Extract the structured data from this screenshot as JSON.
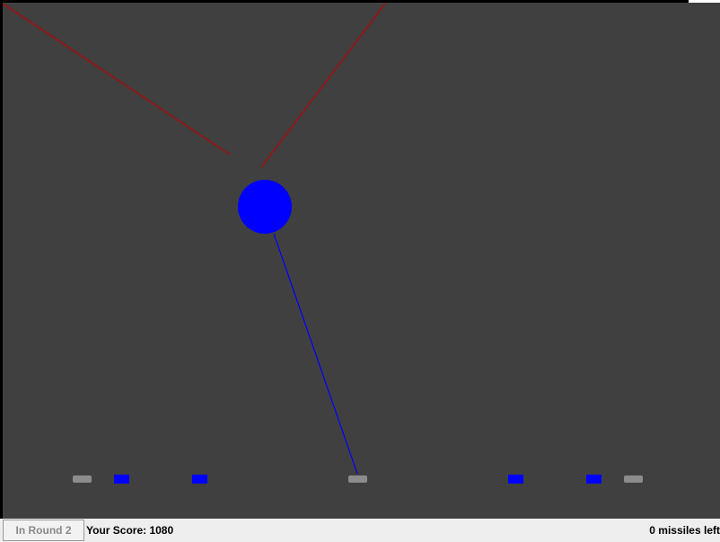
{
  "game": {
    "colors": {
      "background": "#404040",
      "enemy_missile_trail": "#8b1a1a",
      "player_missile": "#0000ff",
      "explosion": "#0000ff",
      "active_target": "#0000ff",
      "destroyed_target": "#8c8c8c"
    },
    "enemy_missile_count": 2,
    "player_missile_count": 1,
    "explosion_count": 1,
    "ground_targets": [
      {
        "state": "destroyed"
      },
      {
        "state": "active"
      },
      {
        "state": "active"
      },
      {
        "state": "destroyed"
      },
      {
        "state": "active"
      },
      {
        "state": "active"
      },
      {
        "state": "destroyed"
      }
    ]
  },
  "status_bar": {
    "round_button_label": "In Round 2",
    "score_label": "Your Score: 1080",
    "missiles_label": "0 missiles left"
  }
}
